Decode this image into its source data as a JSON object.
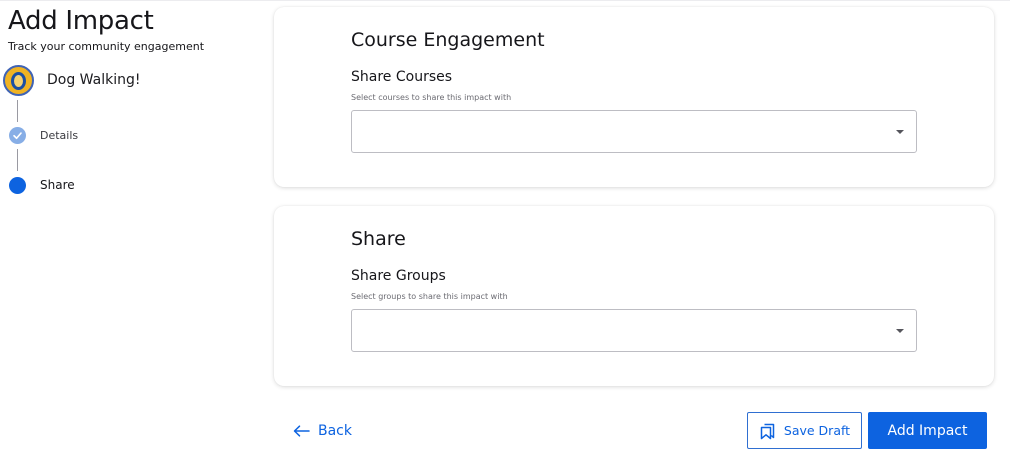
{
  "header": {
    "title": "Add Impact",
    "subtitle": "Track your community engagement"
  },
  "project": {
    "name": "Dog Walking!"
  },
  "steps": [
    {
      "label": "Details",
      "state": "complete",
      "icon": "check-icon"
    },
    {
      "label": "Share",
      "state": "active"
    }
  ],
  "course_card": {
    "title": "Course Engagement",
    "field_label": "Share Courses",
    "field_help": "Select courses to share this impact with",
    "value": ""
  },
  "share_card": {
    "title": "Share",
    "field_label": "Share Groups",
    "field_help": "Select groups to share this impact with",
    "value": ""
  },
  "footer": {
    "back_label": "Back",
    "save_draft_label": "Save Draft",
    "submit_label": "Add Impact"
  },
  "colors": {
    "primary": "#0d63e0",
    "step_complete": "#87aee6",
    "logo_gold": "#f0b323",
    "logo_blue": "#1c4fa3"
  }
}
